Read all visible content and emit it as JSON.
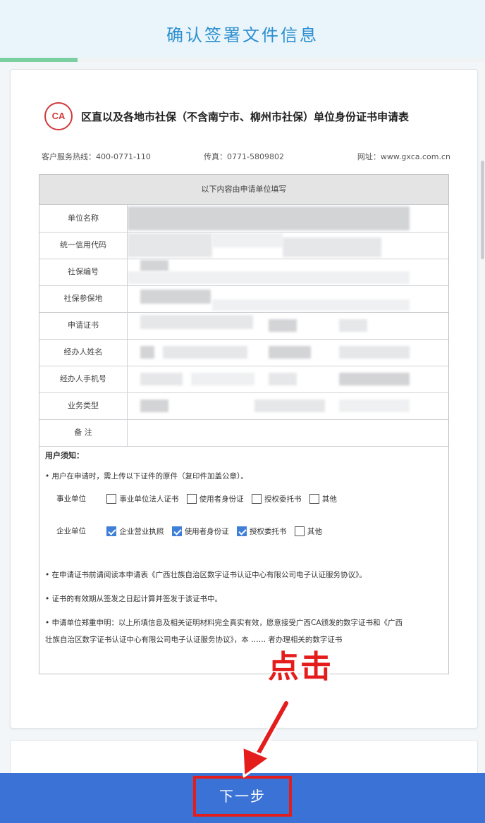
{
  "header": {
    "title": "确认签署文件信息",
    "progress": 0.16
  },
  "document": {
    "logo_text": "CA",
    "title": "区直以及各地市社保（不含南宁市、柳州市社保）单位身份证书申请表",
    "hotline": "客户服务热线：400-0771-110",
    "fax": "传真：0771-5809802",
    "website": "网址：www.gxca.com.cn",
    "section_header": "以下内容由申请单位填写",
    "fields": [
      {
        "label": "单位名称"
      },
      {
        "label": "统一信用代码"
      },
      {
        "label": "社保编号"
      },
      {
        "label": "社保参保地"
      },
      {
        "label": "申请证书"
      },
      {
        "label": "经办人姓名"
      },
      {
        "label": "经办人手机号"
      },
      {
        "label": "业务类型"
      },
      {
        "label": "备 注"
      }
    ],
    "notice": {
      "title": "用户须知：",
      "line1": "• 用户在申请时，需上传以下证件的原件（复印件加盖公章）。",
      "public_label": "事业单位",
      "public_options": [
        {
          "label": "事业单位法人证书",
          "checked": false
        },
        {
          "label": "使用者身份证",
          "checked": false
        },
        {
          "label": "授权委托书",
          "checked": false
        },
        {
          "label": "其他",
          "checked": false
        }
      ],
      "enterprise_label": "企业单位",
      "enterprise_options": [
        {
          "label": "企业营业执照",
          "checked": true
        },
        {
          "label": "使用者身份证",
          "checked": true
        },
        {
          "label": "授权委托书",
          "checked": true
        },
        {
          "label": "其他",
          "checked": false
        }
      ],
      "line2": "• 在申请证书前请阅读本申请表《广西壮族自治区数字证书认证中心有限公司电子认证服务协议》。",
      "line3": "• 证书的有效期从签发之日起计算并签发于该证书中。",
      "line4": "• 申请单位郑重申明：以上所填信息及相关证明材料完全真实有效，愿意接受广西CA颁发的数字证书和《广西",
      "line5": "壮族自治区数字证书认证中心有限公司电子认证服务协议》，本 …… 者办理相关的数字证书"
    }
  },
  "footer": {
    "next_button": "下一步"
  },
  "annotation": {
    "label": "点击"
  },
  "colors": {
    "header_bg": "#e9f5fb",
    "title_blue": "#2d8fcf",
    "progress_green": "#7ad0a0",
    "button_blue": "#3a72d6",
    "annotation_red": "#e41c1c",
    "checkbox_blue": "#3f7fd8"
  }
}
